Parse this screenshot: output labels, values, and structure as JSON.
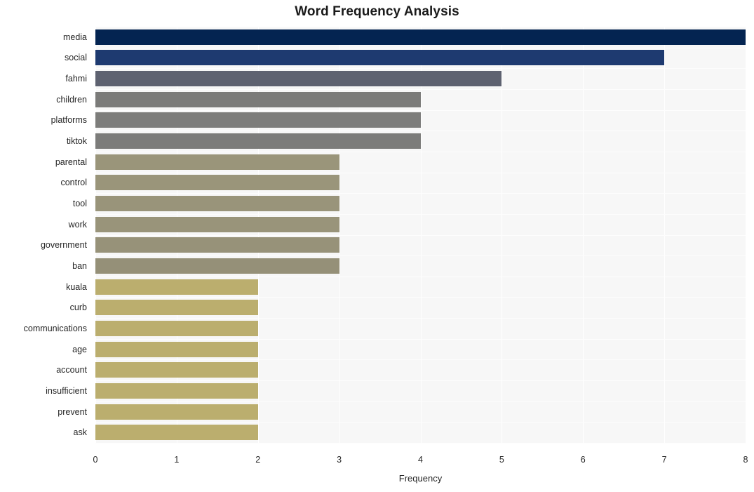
{
  "chart_data": {
    "type": "bar",
    "orientation": "horizontal",
    "title": "Word Frequency Analysis",
    "xlabel": "Frequency",
    "ylabel": "",
    "xlim": [
      0,
      8
    ],
    "xticks": [
      "0",
      "1",
      "2",
      "3",
      "4",
      "5",
      "6",
      "7",
      "8"
    ],
    "xtick_values": [
      0,
      1,
      2,
      3,
      4,
      5,
      6,
      7,
      8
    ],
    "grid": true,
    "grid_axis": "both",
    "grid_color": "#ffffff",
    "plot_background": "#f7f7f7",
    "figure_background": "#ffffff",
    "legend": null,
    "categories": [
      "media",
      "social",
      "fahmi",
      "children",
      "platforms",
      "tiktok",
      "parental",
      "control",
      "tool",
      "work",
      "government",
      "ban",
      "kuala",
      "curb",
      "communications",
      "age",
      "account",
      "insufficient",
      "prevent",
      "ask"
    ],
    "values": [
      8,
      7,
      5,
      4,
      4,
      4,
      3,
      3,
      3,
      3,
      3,
      3,
      2,
      2,
      2,
      2,
      2,
      2,
      2,
      2
    ],
    "bar_colors": [
      "#042451",
      "#1e3a70",
      "#5e6270",
      "#7b7b79",
      "#7d7d7b",
      "#7c7c7a",
      "#9a957a",
      "#9a957a",
      "#99947a",
      "#99947a",
      "#979279",
      "#959078",
      "#bbae6e",
      "#bbae6e",
      "#bbae6e",
      "#bbae6e",
      "#bbae6e",
      "#bbae6e",
      "#bbae6e",
      "#bbae6e"
    ]
  }
}
